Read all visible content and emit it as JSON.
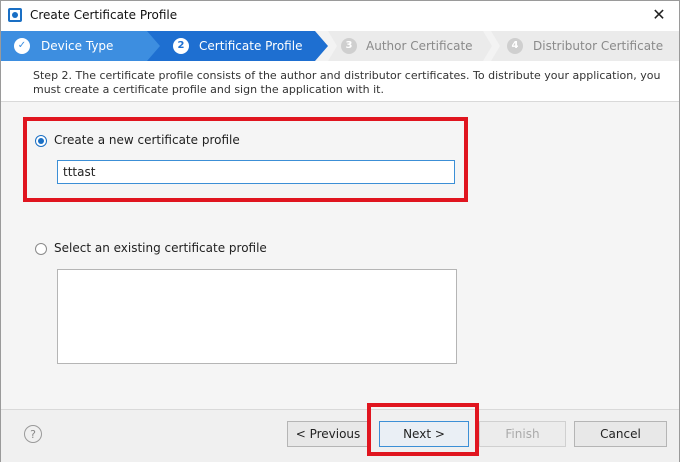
{
  "window": {
    "title": "Create Certificate Profile"
  },
  "steps": [
    {
      "number": "✓",
      "label": "Device Type"
    },
    {
      "number": "2",
      "label": "Certificate Profile"
    },
    {
      "number": "3",
      "label": "Author Certificate"
    },
    {
      "number": "4",
      "label": "Distributor Certificate"
    }
  ],
  "description": "Step 2. The certificate profile consists of the author and distributor certificates. To distribute your application, you must create a certificate profile and sign the application with it.",
  "options": {
    "new_label": "Create a new certificate profile",
    "new_value": "tttast",
    "existing_label": "Select an existing certificate profile"
  },
  "buttons": {
    "help": "?",
    "previous": "< Previous",
    "next": "Next >",
    "finish": "Finish",
    "cancel": "Cancel"
  },
  "colors": {
    "step_done": "#3d8ee0",
    "step_active": "#1e6fd1",
    "step_inactive": "#e9e9e9",
    "highlight": "#e0151f"
  },
  "icons": {
    "close": "close-icon",
    "check": "check-icon",
    "help": "help-icon"
  }
}
